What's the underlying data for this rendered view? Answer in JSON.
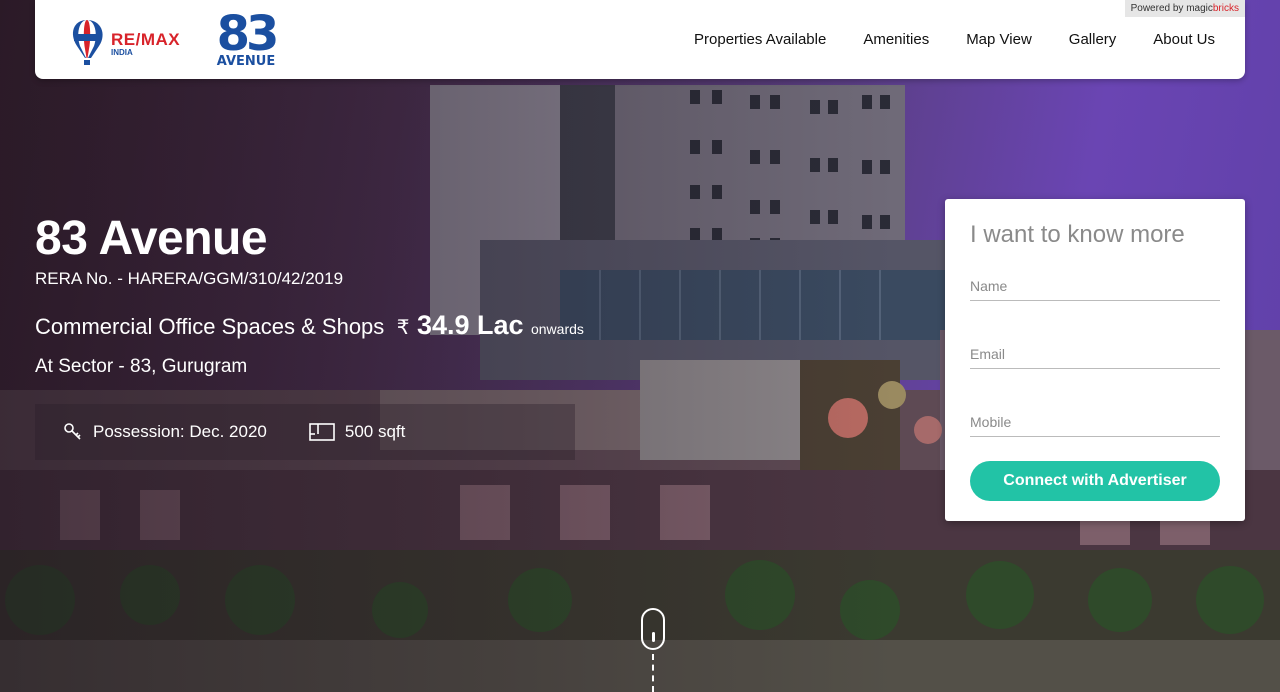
{
  "header": {
    "powered_prefix": "Powered by",
    "powered_brand_magic": "magic",
    "powered_brand_bricks": "bricks",
    "logo_remax_text": "RE/MAX",
    "logo_remax_sub": "INDIA",
    "logo_project_number": "83",
    "logo_project_word": "AVENUE",
    "nav": [
      {
        "label": "Properties Available"
      },
      {
        "label": "Amenities"
      },
      {
        "label": "Map View"
      },
      {
        "label": "Gallery"
      },
      {
        "label": "About Us"
      }
    ]
  },
  "hero": {
    "title": "83 Avenue",
    "rera": "RERA No. - HARERA/GGM/310/42/2019",
    "property_type": "Commercial Office Spaces & Shops",
    "currency_symbol": "₹",
    "price": "34.9 Lac",
    "price_suffix": "onwards",
    "location": "At Sector - 83, Gurugram",
    "facts": [
      {
        "icon": "key-icon",
        "label": "Possession: Dec. 2020"
      },
      {
        "icon": "floorplan-icon",
        "label": "500 sqft"
      }
    ]
  },
  "form": {
    "heading": "I want to know more",
    "name_placeholder": "Name",
    "email_placeholder": "Email",
    "mobile_placeholder": "Mobile",
    "submit_label": "Connect with Advertiser"
  },
  "colors": {
    "accent": "#22c3a6",
    "brand_red": "#d8232a",
    "brand_blue": "#1b4fa0"
  }
}
